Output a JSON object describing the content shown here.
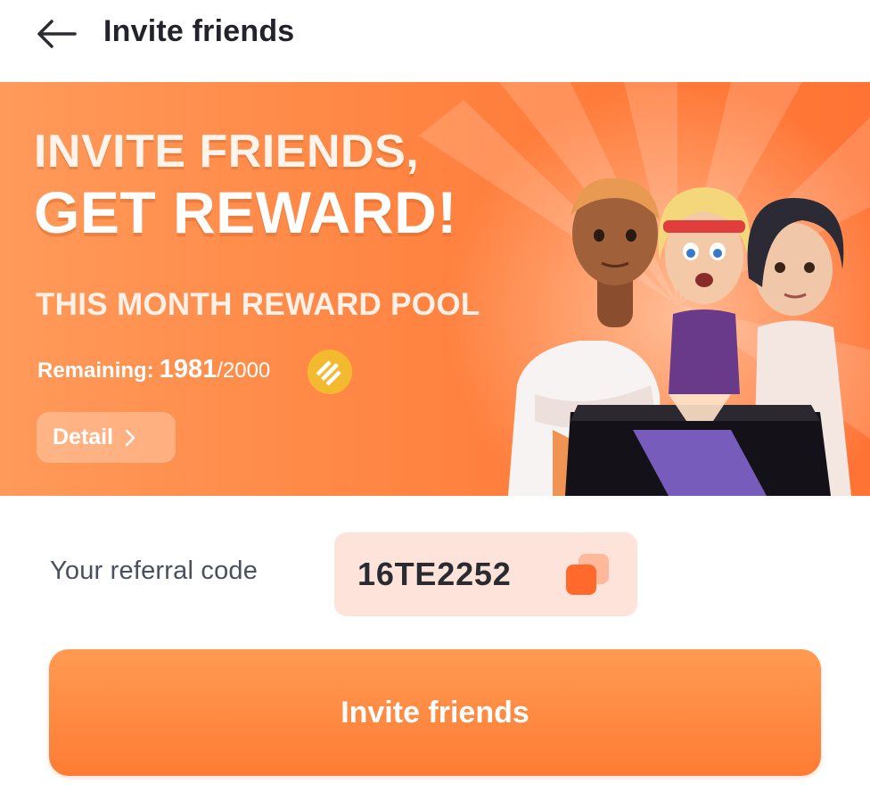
{
  "header": {
    "title": "Invite friends",
    "back_icon": "arrow-left-icon"
  },
  "banner": {
    "title_line1": "INVITE FRIENDS,",
    "title_line2": "GET REWARD!",
    "pool_title": "THIS MONTH REWARD POOL",
    "remaining_label": "Remaining:",
    "remaining_current": "1981",
    "remaining_separator": "/",
    "remaining_total": "2000",
    "coin_icon": "binance-coin-icon",
    "detail_label": "Detail",
    "detail_icon": "chevron-right-icon"
  },
  "referral": {
    "label": "Your referral code",
    "code": "16TE2252",
    "copy_icon": "copy-icon"
  },
  "invite_button": {
    "label": "Invite friends"
  },
  "colors": {
    "accent": "#ff7c34",
    "banner_start": "#ff9a5a",
    "code_bg": "#fde3da",
    "coin": "#f3ba2f"
  }
}
